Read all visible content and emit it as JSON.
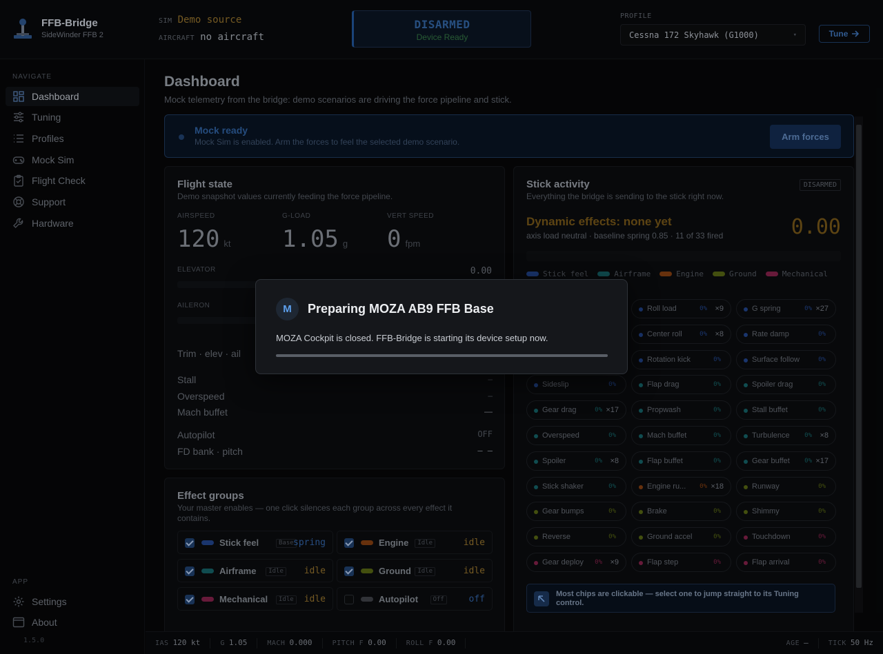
{
  "brand": {
    "name": "FFB-Bridge",
    "device": "SideWinder FFB 2"
  },
  "sim": {
    "sim_key": "SIM",
    "sim_val": "Demo source",
    "ac_key": "AIRCRAFT",
    "ac_val": "no aircraft"
  },
  "arm": {
    "state": "DISARMED",
    "status": "Device Ready"
  },
  "profile": {
    "label": "PROFILE",
    "value": "Cessna 172 Skyhawk (G1000)",
    "caret": "▾",
    "tune": "Tune"
  },
  "nav": {
    "label": "NAVIGATE",
    "items": [
      "Dashboard",
      "Tuning",
      "Profiles",
      "Mock Sim",
      "Flight Check",
      "Support",
      "Hardware"
    ],
    "app_label": "APP",
    "app_items": [
      "Settings",
      "About"
    ],
    "version": "1.5.0"
  },
  "page": {
    "title": "Dashboard",
    "subtitle": "Mock telemetry from the bridge: demo scenarios are driving the force pipeline and stick."
  },
  "banner": {
    "title": "Mock ready",
    "text": "Mock Sim is enabled. Arm the forces to feel the selected demo scenario.",
    "button": "Arm forces"
  },
  "flight": {
    "title": "Flight state",
    "subtitle": "Demo snapshot values currently feeding the force pipeline.",
    "metrics": [
      {
        "label": "AIRSPEED",
        "value": "120",
        "unit": "kt"
      },
      {
        "label": "G-LOAD",
        "value": "1.05",
        "unit": "g"
      },
      {
        "label": "VERT SPEED",
        "value": "0",
        "unit": "fpm"
      }
    ],
    "elevator_label": "ELEVATOR",
    "elevator_value": "0.00",
    "aileron_label": "AILERON",
    "trim_label": "Trim · elev · ail",
    "status_rows": [
      {
        "k": "Stall",
        "v": "–"
      },
      {
        "k": "Overspeed",
        "v": "–"
      },
      {
        "k": "Mach buffet",
        "v": "—"
      }
    ],
    "ap_rows": [
      {
        "k": "Autopilot",
        "v": "OFF"
      },
      {
        "k": "FD bank · pitch",
        "v": "– –"
      }
    ]
  },
  "groups": {
    "title": "Effect groups",
    "subtitle": "Your master enables — one click silences each group across every effect it contains.",
    "items": [
      {
        "name": "Stick feel",
        "tag": "Base",
        "value": "spring",
        "color": "#1f3f80",
        "vcolor": "#2e5c9a",
        "checked": true
      },
      {
        "name": "Engine",
        "tag": "Idle",
        "value": "idle",
        "color": "#7a3a10",
        "vcolor": "#8a6a2a",
        "checked": true
      },
      {
        "name": "Airframe",
        "tag": "Idle",
        "value": "idle",
        "color": "#135a5e",
        "vcolor": "#8a6a2a",
        "checked": true
      },
      {
        "name": "Ground",
        "tag": "Idle",
        "value": "idle",
        "color": "#4f5d12",
        "vcolor": "#8a6a2a",
        "checked": true
      },
      {
        "name": "Mechanical",
        "tag": "Idle",
        "value": "idle",
        "color": "#7a1f45",
        "vcolor": "#8a6a2a",
        "checked": true
      },
      {
        "name": "Autopilot",
        "tag": "Off",
        "value": "off",
        "color": "#3a3d42",
        "vcolor": "#2e5c9a",
        "checked": false
      }
    ]
  },
  "stick": {
    "title": "Stick activity",
    "subtitle": "Everything the bridge is sending to the stick right now.",
    "badge": "DISARMED",
    "dyn_title": "Dynamic effects: none yet",
    "dyn_sub": "axis load neutral · baseline spring 0.85 · 11 of 33 fired",
    "dyn_value": "0.00",
    "legend": [
      {
        "n": "Stick feel",
        "c": "#1f3f80"
      },
      {
        "n": "Airframe",
        "c": "#135a5e"
      },
      {
        "n": "Engine",
        "c": "#7a3a10"
      },
      {
        "n": "Ground",
        "c": "#4f5d12"
      },
      {
        "n": "Mechanical",
        "c": "#7a1f45"
      }
    ],
    "chips": [
      {
        "n": "",
        "p": "",
        "x": "",
        "c": "#1f3f80",
        "hidden": true
      },
      {
        "n": "Roll load",
        "p": "0%",
        "x": "×9",
        "c": "#1f3f80"
      },
      {
        "n": "G spring",
        "p": "0%",
        "x": "×27",
        "c": "#1f3f80"
      },
      {
        "n": "",
        "p": "",
        "x": "",
        "c": "#1f3f80",
        "hidden": true
      },
      {
        "n": "Center roll",
        "p": "0%",
        "x": "×8",
        "c": "#1f3f80"
      },
      {
        "n": "Rate damp",
        "p": "0%",
        "x": "",
        "c": "#1f3f80"
      },
      {
        "n": "",
        "p": "",
        "x": "",
        "c": "#1f3f80",
        "hidden": true
      },
      {
        "n": "Rotation kick",
        "p": "0%",
        "x": "",
        "c": "#1f3f80"
      },
      {
        "n": "Surface follow",
        "p": "0%",
        "x": "",
        "c": "#1f3f80"
      },
      {
        "n": "Sideslip",
        "p": "0%",
        "x": "",
        "c": "#1f3f80"
      },
      {
        "n": "Flap drag",
        "p": "0%",
        "x": "",
        "c": "#135a5e"
      },
      {
        "n": "Spoiler drag",
        "p": "0%",
        "x": "",
        "c": "#135a5e"
      },
      {
        "n": "Gear drag",
        "p": "0%",
        "x": "×17",
        "c": "#135a5e"
      },
      {
        "n": "Propwash",
        "p": "0%",
        "x": "",
        "c": "#135a5e"
      },
      {
        "n": "Stall buffet",
        "p": "0%",
        "x": "",
        "c": "#135a5e"
      },
      {
        "n": "Overspeed",
        "p": "0%",
        "x": "",
        "c": "#135a5e"
      },
      {
        "n": "Mach buffet",
        "p": "0%",
        "x": "",
        "c": "#135a5e"
      },
      {
        "n": "Turbulence",
        "p": "0%",
        "x": "×8",
        "c": "#135a5e"
      },
      {
        "n": "Spoiler",
        "p": "0%",
        "x": "×8",
        "c": "#135a5e"
      },
      {
        "n": "Flap buffet",
        "p": "0%",
        "x": "",
        "c": "#135a5e"
      },
      {
        "n": "Gear buffet",
        "p": "0%",
        "x": "×17",
        "c": "#135a5e"
      },
      {
        "n": "Stick shaker",
        "p": "0%",
        "x": "",
        "c": "#135a5e"
      },
      {
        "n": "Engine ru...",
        "p": "0%",
        "x": "×18",
        "c": "#7a3a10"
      },
      {
        "n": "Runway",
        "p": "0%",
        "x": "",
        "c": "#4f5d12"
      },
      {
        "n": "Gear bumps",
        "p": "0%",
        "x": "",
        "c": "#4f5d12"
      },
      {
        "n": "Brake",
        "p": "0%",
        "x": "",
        "c": "#4f5d12"
      },
      {
        "n": "Shimmy",
        "p": "0%",
        "x": "",
        "c": "#4f5d12"
      },
      {
        "n": "Reverse",
        "p": "0%",
        "x": "",
        "c": "#4f5d12"
      },
      {
        "n": "Ground accel",
        "p": "0%",
        "x": "",
        "c": "#4f5d12"
      },
      {
        "n": "Touchdown",
        "p": "0%",
        "x": "",
        "c": "#7a1f45"
      },
      {
        "n": "Gear deploy",
        "p": "0%",
        "x": "×9",
        "c": "#7a1f45"
      },
      {
        "n": "Flap step",
        "p": "0%",
        "x": "",
        "c": "#7a1f45"
      },
      {
        "n": "Flap arrival",
        "p": "0%",
        "x": "",
        "c": "#7a1f45"
      }
    ],
    "hint": "Most chips are clickable — select one to jump straight to its Tuning control."
  },
  "footer": {
    "items": [
      {
        "k": "IAS",
        "v": "120 kt"
      },
      {
        "k": "G",
        "v": "1.05"
      },
      {
        "k": "MACH",
        "v": "0.000"
      },
      {
        "k": "PITCH F",
        "v": "0.00"
      },
      {
        "k": "ROLL F",
        "v": "0.00"
      }
    ],
    "age_k": "AGE",
    "age_v": "—",
    "tick_k": "TICK",
    "tick_v": "50 Hz"
  },
  "modal": {
    "icon": "M",
    "title": "Preparing MOZA AB9 FFB Base",
    "body": "MOZA Cockpit is closed. FFB-Bridge is starting its device setup now."
  },
  "colors": {
    "accent": "#2e5c9a",
    "warn": "#6e5117",
    "ready": "#2f6b3e"
  }
}
